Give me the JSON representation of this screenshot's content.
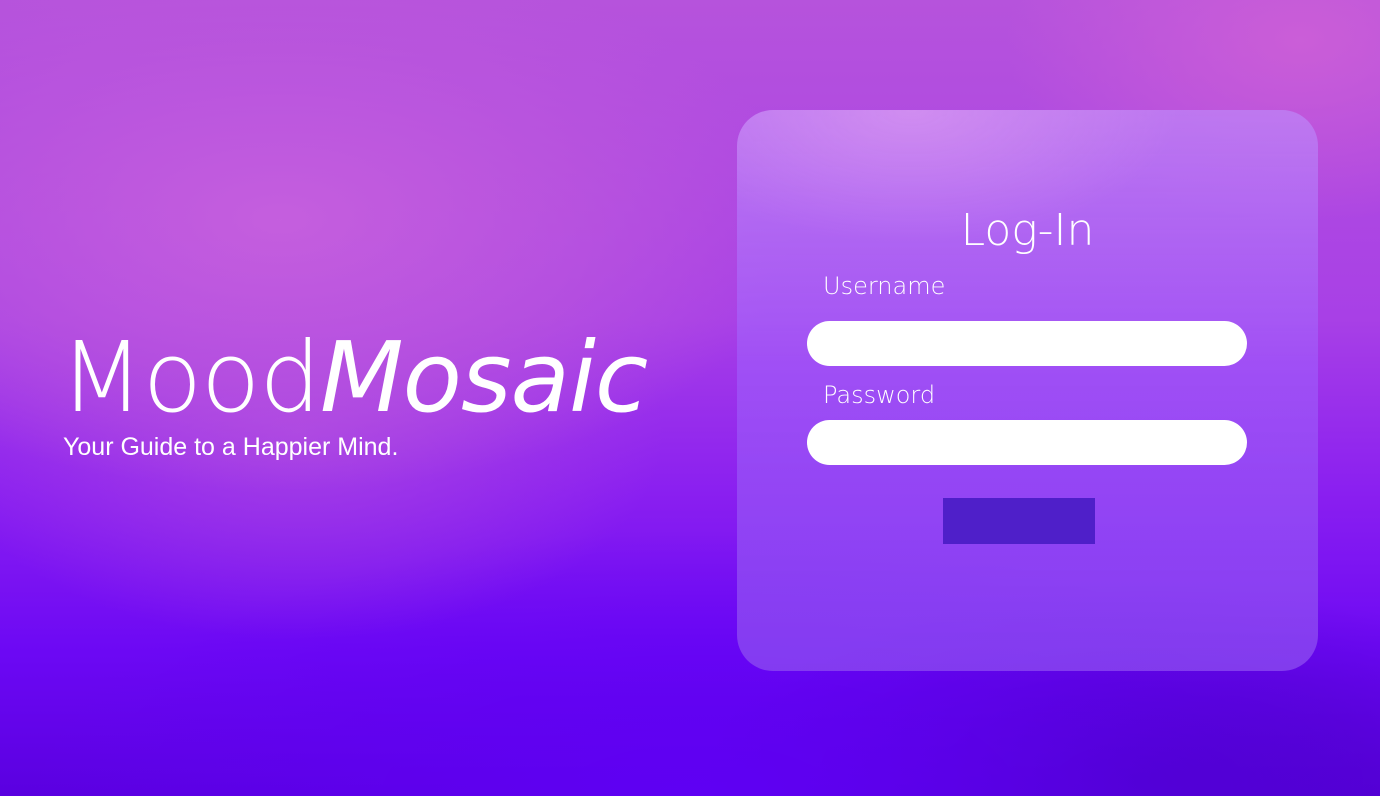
{
  "brand": {
    "title_part1": "Mood",
    "title_part2": "Mosaic",
    "tagline": "Your Guide to a Happier Mind."
  },
  "login": {
    "title": "Log-In",
    "username_label": "Username",
    "username_value": "",
    "password_label": "Password",
    "password_value": "",
    "submit_label": ""
  },
  "colors": {
    "card_button": "#4f1fc9",
    "input_background": "#ffffff",
    "text": "#ffffff"
  }
}
